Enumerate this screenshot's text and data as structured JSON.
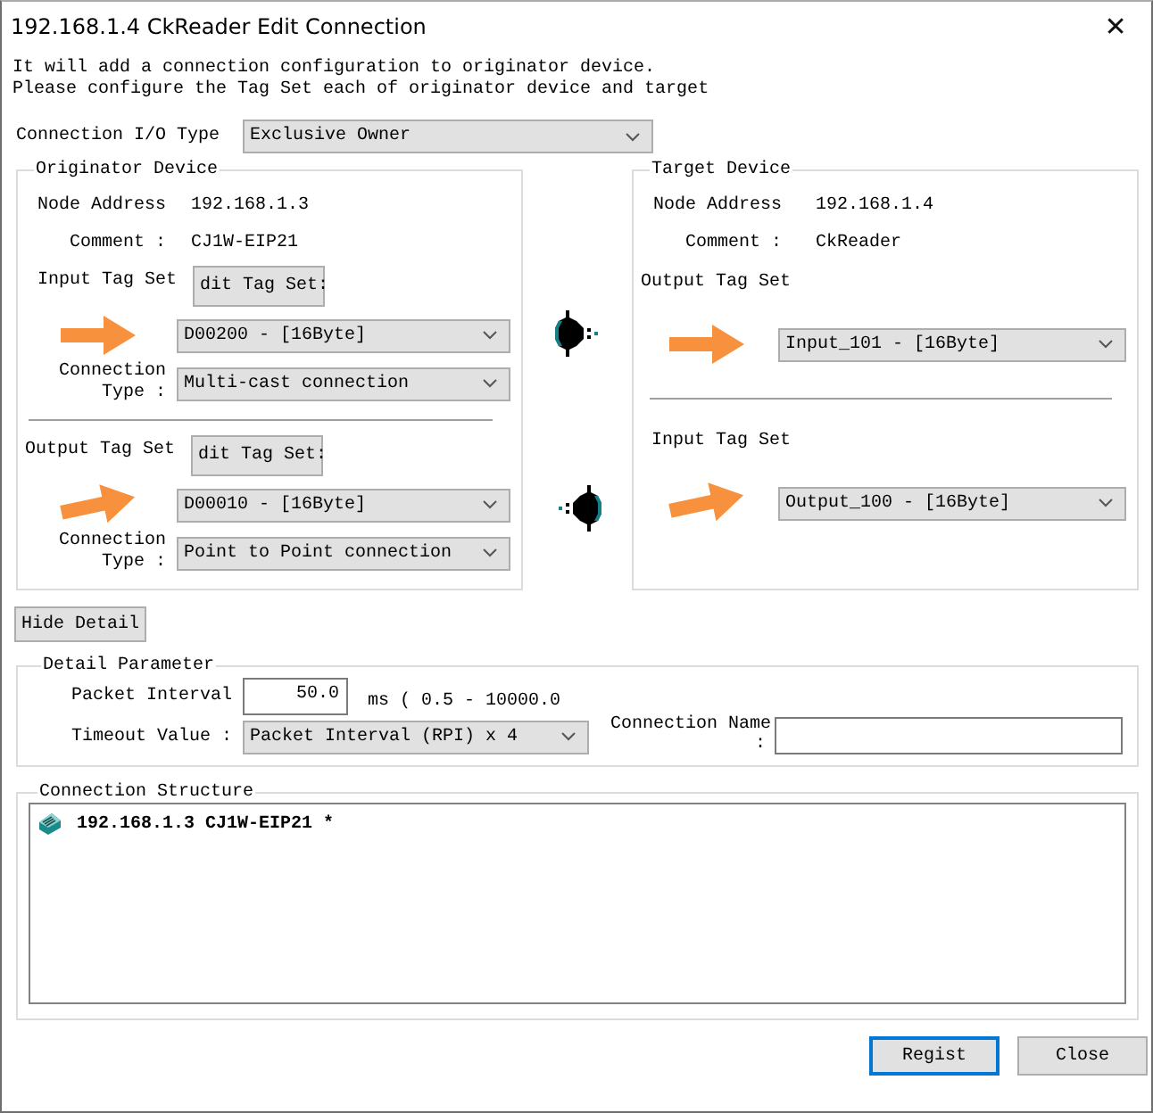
{
  "window": {
    "title": "192.168.1.4 CkReader Edit Connection",
    "close": "✕"
  },
  "intro": [
    "It will add a connection configuration to originator device.",
    "Please configure the Tag Set each of originator device and target"
  ],
  "io_type": {
    "label": "Connection I/O Type",
    "value": "Exclusive Owner"
  },
  "originator": {
    "title": "Originator Device",
    "node_address_label": "Node Address",
    "node_address": "192.168.1.3",
    "comment_label": "Comment :",
    "comment": "CJ1W-EIP21",
    "sections": [
      {
        "label": "Input Tag Set",
        "button": "dit Tag Set:",
        "tag_set": "D00200 - [16Byte]",
        "type_label": [
          "Connection",
          "Type :"
        ],
        "type": "Multi-cast connection"
      },
      {
        "label": "Output Tag Set",
        "button": "dit Tag Set:",
        "tag_set": "D00010 - [16Byte]",
        "type_label": [
          "Connection",
          "Type :"
        ],
        "type": "Point to Point connection"
      }
    ]
  },
  "flows": [
    {
      "kind": "outgoing"
    },
    {
      "kind": "incoming"
    }
  ],
  "target": {
    "title": "Target Device",
    "node_address_label": "Node Address",
    "node_address": "192.168.1.4",
    "comment_label": "Comment :",
    "comment": "CkReader",
    "sections": [
      {
        "label": "Output Tag Set",
        "tag_set": "Input_101 - [16Byte]"
      },
      {
        "label": "Input Tag Set",
        "tag_set": "Output_100 - [16Byte]"
      }
    ]
  },
  "hide_detail_button": "Hide Detail",
  "detail": {
    "title": "Detail Parameter",
    "packet_interval_label": "Packet Interval",
    "packet_interval": "50.0",
    "range": "ms ( 0.5 - 10000.0",
    "timeout_label": "Timeout Value :",
    "timeout": "Packet Interval (RPI) x 4",
    "connection_name_label": [
      "Connection Name",
      ":"
    ]
  },
  "structure": {
    "title": "Connection Structure",
    "items": [
      {
        "text": "192.168.1.3 CJ1W-EIP21 *"
      }
    ]
  },
  "buttons": [
    {
      "label": "Regist",
      "default": true
    },
    {
      "label": "Close",
      "default": false
    }
  ]
}
